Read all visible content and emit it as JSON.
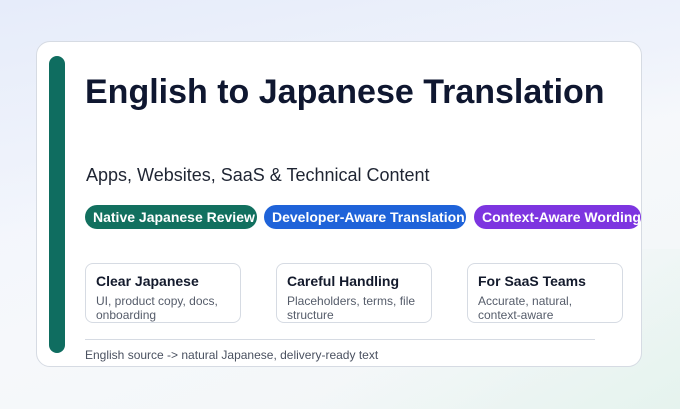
{
  "hero": {
    "title": "English to Japanese Translation",
    "subtitle": "Apps, Websites, SaaS & Technical Content"
  },
  "badges": [
    {
      "label": "Native Japanese Review",
      "color": "#12705f"
    },
    {
      "label": "Developer-Aware Translation",
      "color": "#1f63d9"
    },
    {
      "label": "Context-Aware Wording",
      "color": "#7d35e0"
    }
  ],
  "features": [
    {
      "title": "Clear Japanese",
      "description": "UI, product copy, docs, onboarding"
    },
    {
      "title": "Careful Handling",
      "description": "Placeholders, terms, file structure"
    },
    {
      "title": "For SaaS Teams",
      "description": "Accurate, natural, context-aware"
    }
  ],
  "footer": {
    "note": "English source -> natural Japanese, delivery-ready text"
  },
  "colors": {
    "accent": "#0f6d60",
    "title_text": "#0f1730"
  }
}
